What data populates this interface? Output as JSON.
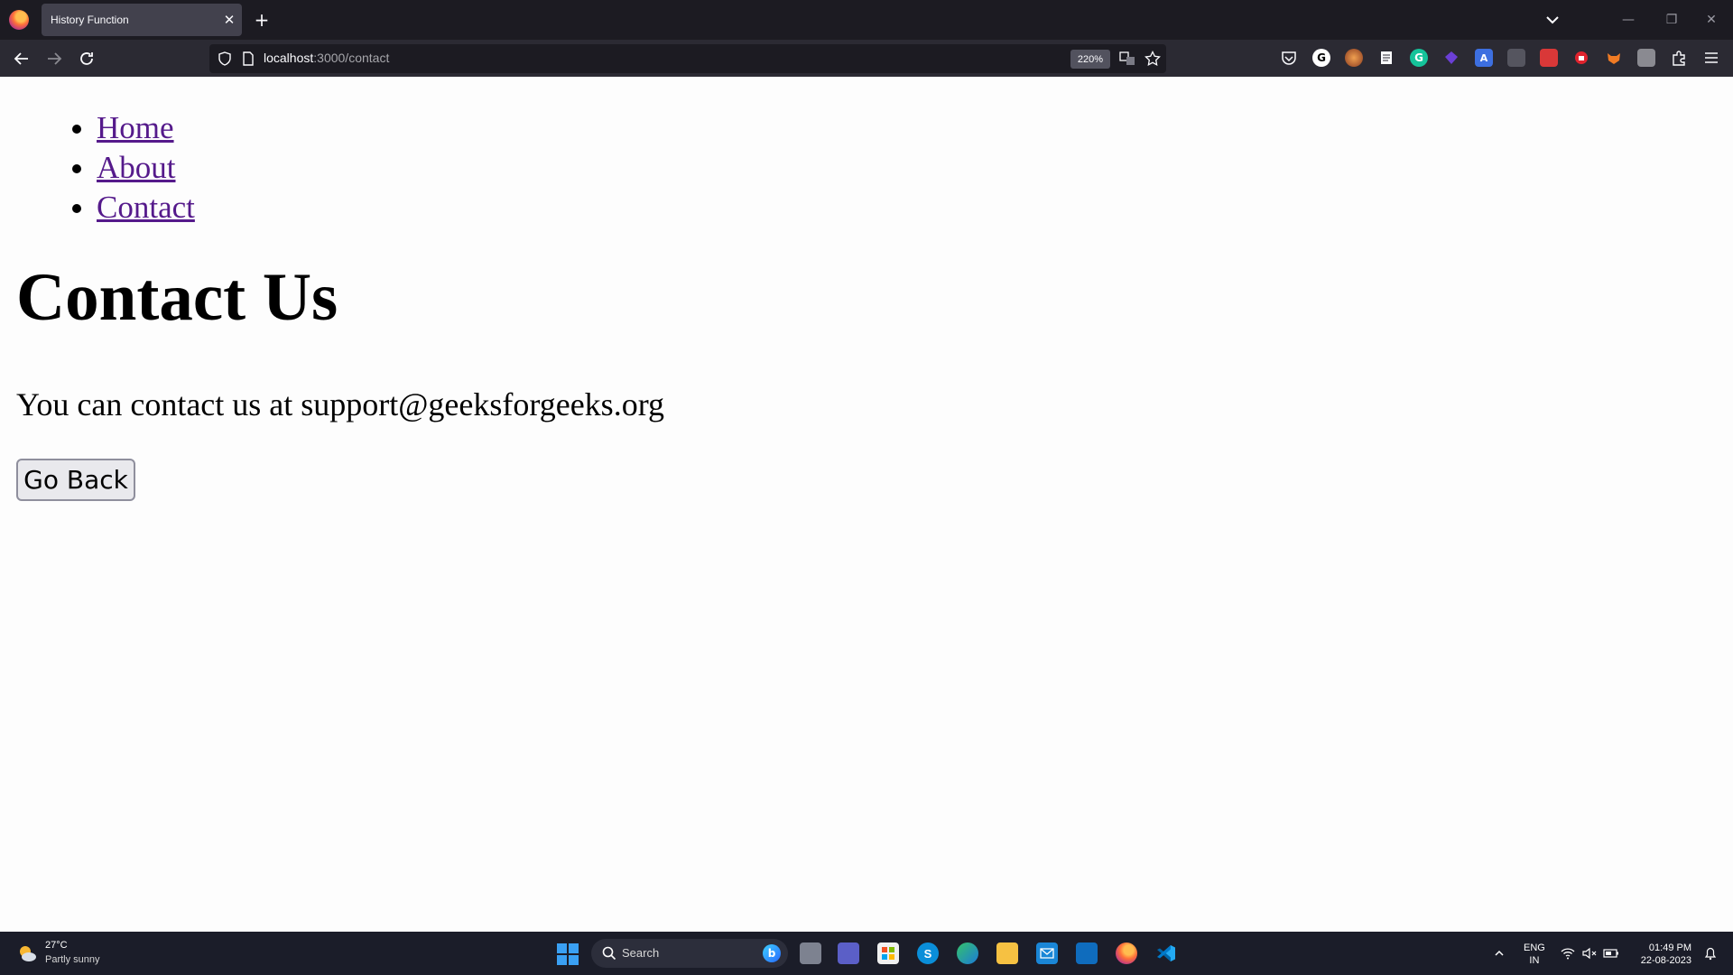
{
  "browser": {
    "tab_title": "History Function",
    "url_host": "localhost",
    "url_path": ":3000/contact",
    "zoom": "220%"
  },
  "page": {
    "nav_links": [
      "Home",
      "About",
      "Contact"
    ],
    "heading": "Contact Us",
    "contact_text": "You can contact us at support@geeksforgeeks.org",
    "back_button": "Go Back"
  },
  "taskbar": {
    "weather_temp": "27°C",
    "weather_desc": "Partly sunny",
    "search_placeholder": "Search",
    "lang_line1": "ENG",
    "lang_line2": "IN",
    "time": "01:49 PM",
    "date": "22-08-2023"
  },
  "colors": {
    "link": "#551a8b",
    "chrome_dark": "#1c1b22",
    "toolbar": "#2b2a33",
    "taskbar": "#1b1d29"
  }
}
